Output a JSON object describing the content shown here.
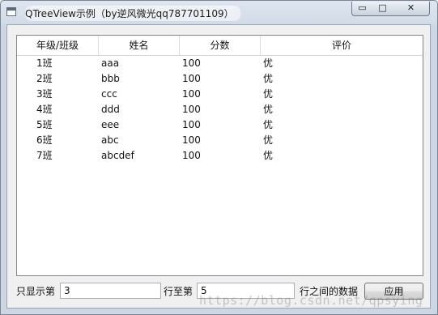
{
  "window": {
    "title": "QTreeView示例（by逆风微光qq787701109）",
    "buttons": {
      "minimize": "▭",
      "maximize": "□",
      "close": "✕"
    }
  },
  "tree": {
    "columns": [
      "年级/班级",
      "姓名",
      "分数",
      "评价"
    ],
    "rows": [
      {
        "class": "1班",
        "name": "aaa",
        "score": "100",
        "rating": "优"
      },
      {
        "class": "2班",
        "name": "bbb",
        "score": "100",
        "rating": "优"
      },
      {
        "class": "3班",
        "name": "ccc",
        "score": "100",
        "rating": "优"
      },
      {
        "class": "4班",
        "name": "ddd",
        "score": "100",
        "rating": "优"
      },
      {
        "class": "5班",
        "name": "eee",
        "score": "100",
        "rating": "优"
      },
      {
        "class": "6班",
        "name": "abc",
        "score": "100",
        "rating": "优"
      },
      {
        "class": "7班",
        "name": "abcdef",
        "score": "100",
        "rating": "优"
      }
    ]
  },
  "filter": {
    "prefix_label": "只显示第",
    "start_value": "3",
    "middle_label": "行至第",
    "end_value": "5",
    "suffix_label": "行之间的数据",
    "apply_label": "应用"
  },
  "watermark": "https://blog.csdn.net/qpsying"
}
